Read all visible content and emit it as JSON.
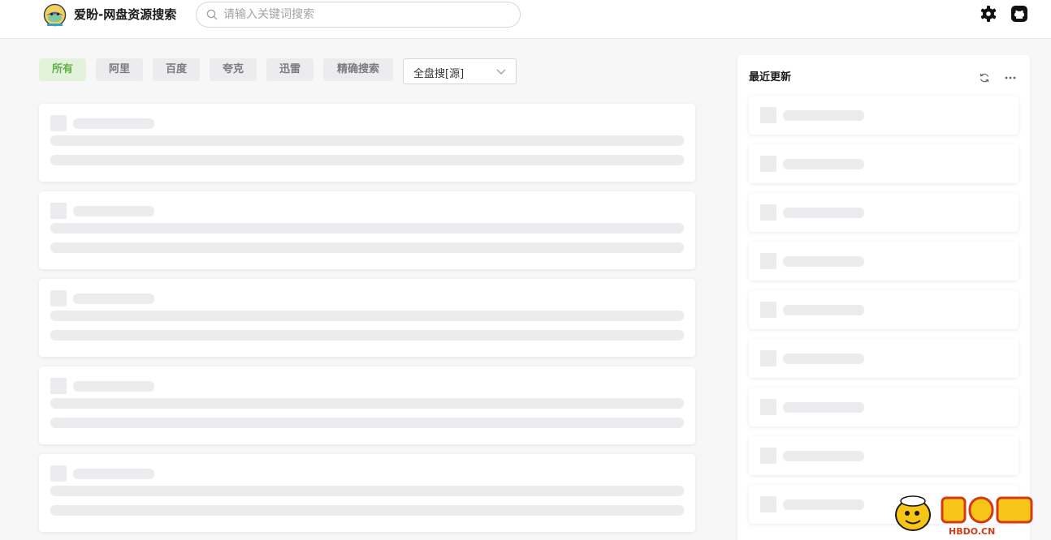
{
  "header": {
    "site_title": "爱盼-网盘资源搜索",
    "search_placeholder": "请输入关键词搜索",
    "search_value": "",
    "icons": [
      "search-icon",
      "settings-icon",
      "github-icon"
    ]
  },
  "filters": {
    "tabs": [
      {
        "label": "所有",
        "active": true
      },
      {
        "label": "阿里",
        "active": false
      },
      {
        "label": "百度",
        "active": false
      },
      {
        "label": "夸克",
        "active": false
      },
      {
        "label": "迅雷",
        "active": false
      },
      {
        "label": "精确搜索",
        "active": false
      }
    ],
    "source_select": {
      "selected": "全盘搜[源]"
    }
  },
  "results": {
    "loading_placeholders": 5
  },
  "sidebar": {
    "title": "最近更新",
    "icons": [
      "refresh-icon",
      "more-icon"
    ],
    "loading_placeholders": 9
  },
  "watermark": {
    "text": "HBDO.CN"
  },
  "colors": {
    "accent_green": "#60b04a",
    "active_tab_bg": "#e3f3db",
    "skeleton": "#ececef",
    "page_bg": "#f7f7f8"
  }
}
